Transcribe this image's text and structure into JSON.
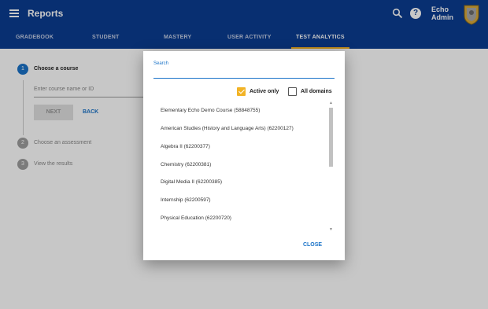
{
  "appbar": {
    "title": "Reports",
    "user_line1": "Echo",
    "user_line2": "Admin",
    "help_glyph": "?",
    "color": "#0b3d91"
  },
  "tabs": [
    {
      "label": "GRADEBOOK",
      "active": false
    },
    {
      "label": "STUDENT",
      "active": false
    },
    {
      "label": "MASTERY",
      "active": false
    },
    {
      "label": "USER ACTIVITY",
      "active": false
    },
    {
      "label": "TEST ANALYTICS",
      "active": true
    }
  ],
  "stepper": {
    "steps": [
      {
        "number": "1",
        "label": "Choose a course",
        "active": true
      },
      {
        "number": "2",
        "label": "Choose an assessment",
        "active": false
      },
      {
        "number": "3",
        "label": "View the results",
        "active": false
      }
    ],
    "course_placeholder": "Enter course name or ID",
    "next_label": "NEXT",
    "back_label": "BACK"
  },
  "dialog": {
    "search_label": "Search",
    "search_value": "",
    "active_only_label": "Active only",
    "active_only_checked": true,
    "all_domains_label": "All domains",
    "all_domains_checked": false,
    "courses": [
      "Elementary Echo Demo Course (58848755)",
      "American Studies (History and Language Arts) (62200127)",
      "Algebra II (62200377)",
      "Chemistry (62200381)",
      "Digital Media II (62200385)",
      "Internship (62200597)",
      "Physical Education (62200720)"
    ],
    "close_label": "CLOSE"
  },
  "colors": {
    "accent": "#1a73c8",
    "checkbox": "#f2b325"
  }
}
